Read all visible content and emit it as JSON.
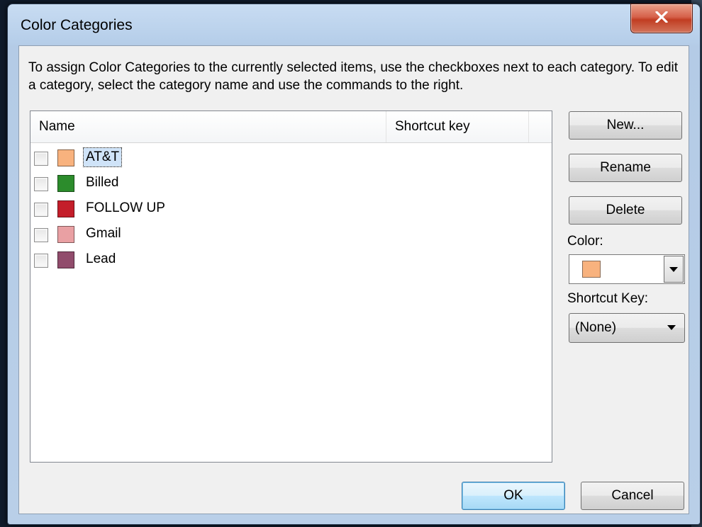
{
  "window": {
    "title": "Color Categories",
    "close_glyph": "✕"
  },
  "instructions": "To assign Color Categories to the currently selected items, use the checkboxes next to each category.  To edit a category, select the category name and use the commands to the right.",
  "list": {
    "columns": [
      "Name",
      "Shortcut key"
    ],
    "rows": [
      {
        "name": "AT&T",
        "color": "#f8b27e",
        "checked": false,
        "selected": true
      },
      {
        "name": "Billed",
        "color": "#2c8c2c",
        "checked": false,
        "selected": false
      },
      {
        "name": "FOLLOW UP",
        "color": "#c41e2a",
        "checked": false,
        "selected": false
      },
      {
        "name": "Gmail",
        "color": "#e9a0a3",
        "checked": false,
        "selected": false
      },
      {
        "name": "Lead",
        "color": "#914c6c",
        "checked": false,
        "selected": false
      }
    ]
  },
  "buttons": {
    "new": "New...",
    "rename": "Rename",
    "delete": "Delete",
    "ok": "OK",
    "cancel": "Cancel"
  },
  "color": {
    "label": "Color:",
    "selected_color": "#f8b27e"
  },
  "shortcut": {
    "label": "Shortcut Key:",
    "value": "(None)"
  }
}
